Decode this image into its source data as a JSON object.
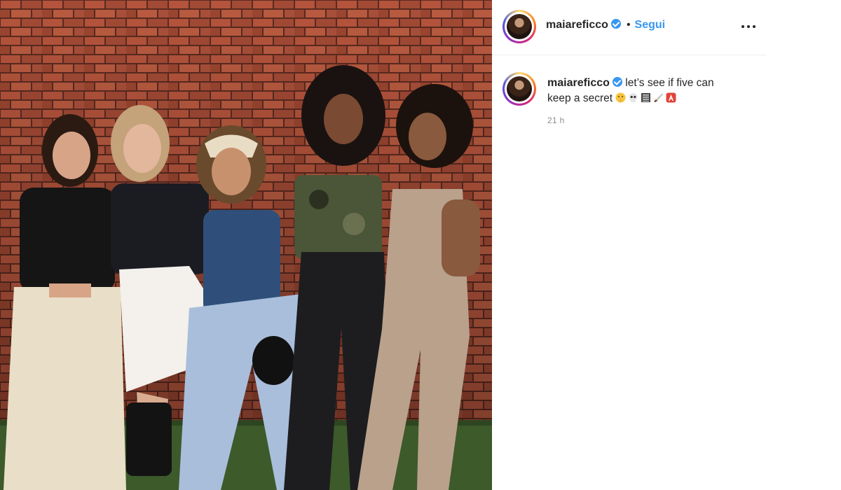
{
  "post": {
    "username": "maiareficco",
    "follow_label": "Segui",
    "separator": "•",
    "caption": "let’s see if five can keep a secret",
    "caption_line1": "let’s see if five can",
    "caption_line2": "keep a secret",
    "caption_emojis": [
      "shushing-face-icon",
      "skull-icon",
      "notebook-icon",
      "knife-icon",
      "letter-a-icon"
    ],
    "timestamp": "21 h"
  },
  "colors": {
    "link_blue": "#3897f0",
    "text": "#262626",
    "muted": "#8e8e8e",
    "divider": "#efefef"
  }
}
